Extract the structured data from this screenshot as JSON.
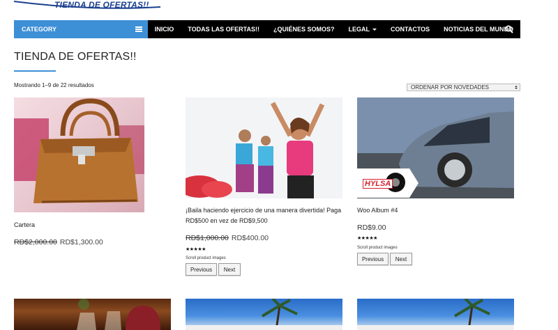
{
  "brand": {
    "logo_text": "TIENDA DE OFERTAS!!",
    "color": "#1a3f8f"
  },
  "nav": {
    "category_label": "CATEGORY",
    "items": [
      {
        "label": "INICIO"
      },
      {
        "label": "TODAS LAS OFERTAS!!"
      },
      {
        "label": "¿QUIÉNES SOMOS?"
      },
      {
        "label": "LEGAL",
        "has_dropdown": true
      },
      {
        "label": "CONTACTOS"
      },
      {
        "label": "NOTICIAS DEL MUNDO"
      }
    ],
    "accent_color": "#3d8fd6",
    "search_icon": "search-icon"
  },
  "page": {
    "title": "TIENDA DE OFERTAS!!",
    "result_count": "Mostrando 1–9 de 22 resultados",
    "orderby_selected": "ORDENAR POR NOVEDADES"
  },
  "products": [
    {
      "name": "Cartera",
      "old_price": "RD$2,000.00",
      "new_price": "RD$1,300.00"
    },
    {
      "name_line1": "¡Baila haciendo ejercicio de una manera divertida! Paga",
      "name_line2": "RD$500 en vez de RD$9,500",
      "old_price": "RD$1,000.00",
      "new_price": "RD$400.00",
      "rating": 4,
      "stars": "★★★★★",
      "scroll_label": "Scroll product images",
      "prev_label": "Previous",
      "next_label": "Next"
    },
    {
      "name": "Woo Album #4",
      "price": "RD$9.00",
      "rating": 5,
      "stars": "★★★★★",
      "scroll_label": "Scroll product images",
      "prev_label": "Previous",
      "next_label": "Next",
      "image_badge": "HYLSA"
    }
  ]
}
